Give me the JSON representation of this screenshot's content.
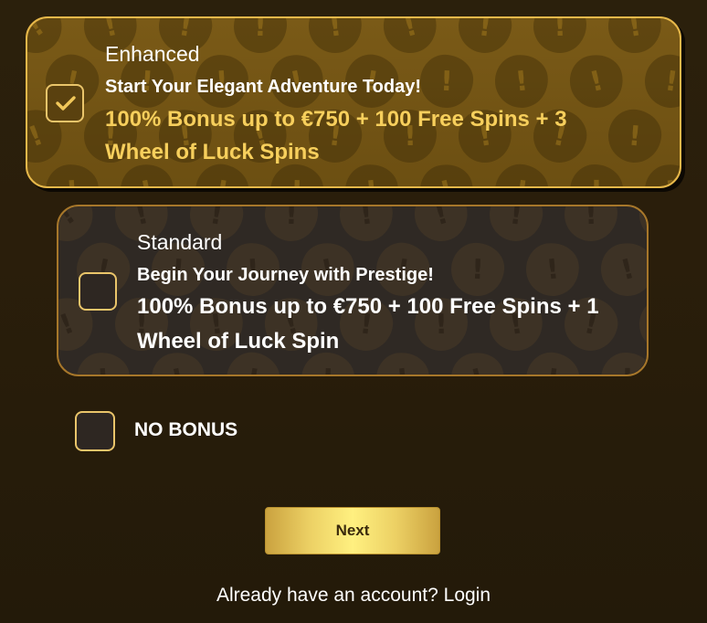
{
  "options": [
    {
      "title": "Enhanced",
      "subtitle": "Start Your Elegant Adventure Today!",
      "offer_line1": "100% Bonus up to €750 + 100 Free Spins + 3",
      "offer_line2": "Wheel of Luck Spins",
      "checked": true
    },
    {
      "title": "Standard",
      "subtitle": "Begin Your Journey with Prestige!",
      "offer_line1": "100% Bonus up to €750 + 100 Free Spins + 1",
      "offer_line2": "Wheel of Luck Spin",
      "checked": false
    }
  ],
  "no_bonus": {
    "label": "NO BONUS",
    "checked": false
  },
  "next_button": {
    "label": "Next"
  },
  "login": {
    "prompt": "Already have an account?",
    "link": "Login"
  },
  "colors": {
    "background": "#2a1e0b",
    "enhanced_card": "#6c4f12",
    "enhanced_border": "#e7b84a",
    "standard_card": "#2f2924",
    "standard_border": "#a7772a",
    "offer_highlight": "#f7cf5c",
    "checkbox_border": "#eac56a",
    "button_gold": "#ecd064"
  },
  "icons": {
    "check": "check-icon",
    "pattern": "exclamation-badge-icon"
  }
}
